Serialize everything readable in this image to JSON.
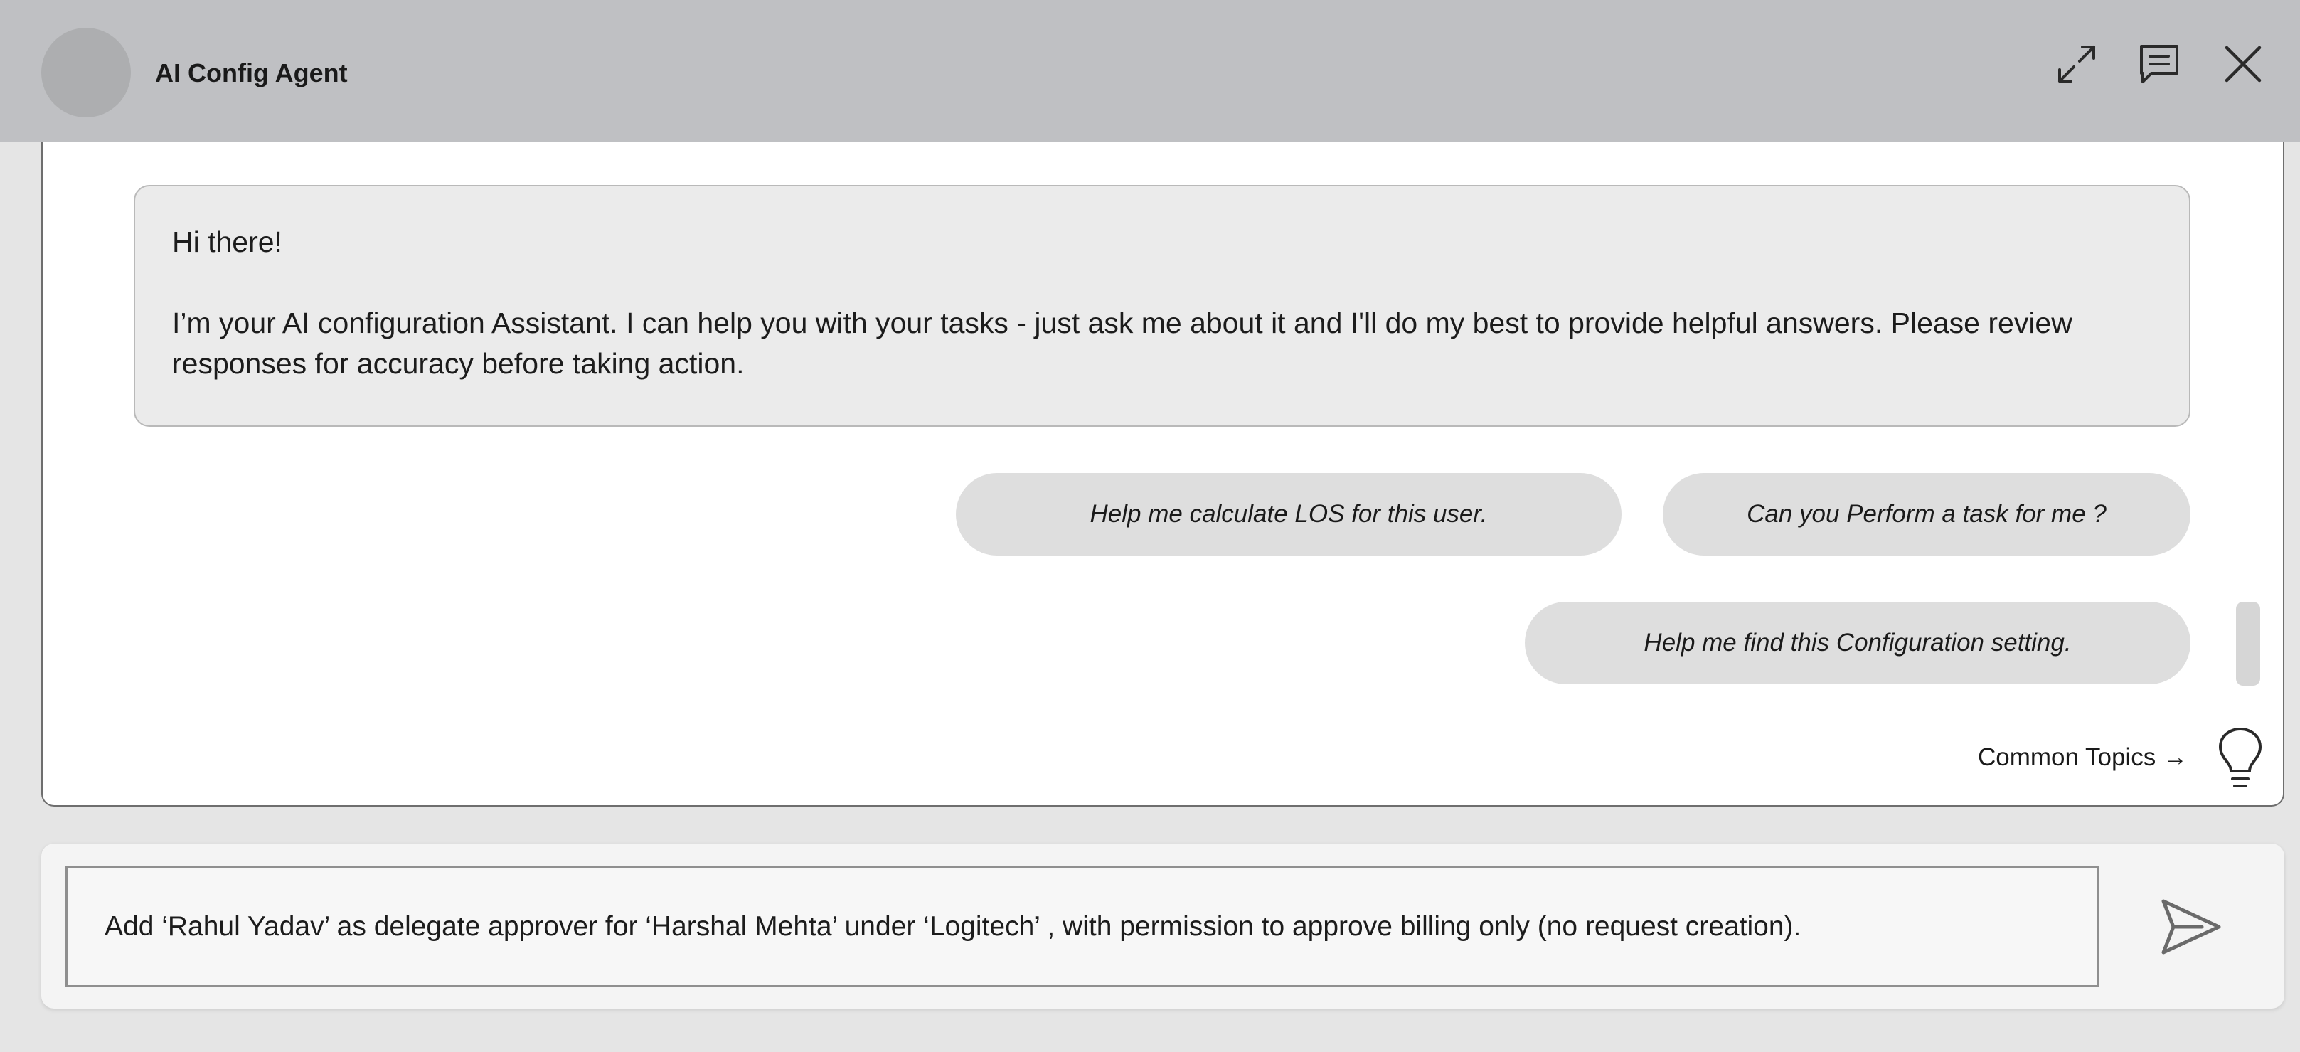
{
  "header": {
    "title": "AI Config Agent",
    "icons": {
      "expand": "expand-arrows-icon",
      "chat": "chat-message-icon",
      "close": "close-icon"
    },
    "background": "#bfc0c3"
  },
  "chat": {
    "assistant_message": {
      "greeting": "Hi there!",
      "body": "I’m your AI configuration Assistant. I can help you with your tasks - just ask me about it and I'll do my best to provide helpful answers. Please review responses for accuracy before taking action."
    },
    "suggestions": [
      "Help me calculate LOS for this user.",
      "Can you Perform a task for me ?",
      "Help me find this Configuration setting."
    ],
    "common_topics_label": "Common Topics →",
    "common_topics_icon": "lightbulb-icon"
  },
  "composer": {
    "input_value": "Add ‘Rahul Yadav’ as delegate approver for ‘Harshal Mehta’ under ‘Logitech’ , with permission to approve billing only (no request creation).",
    "send_icon": "send-icon"
  }
}
